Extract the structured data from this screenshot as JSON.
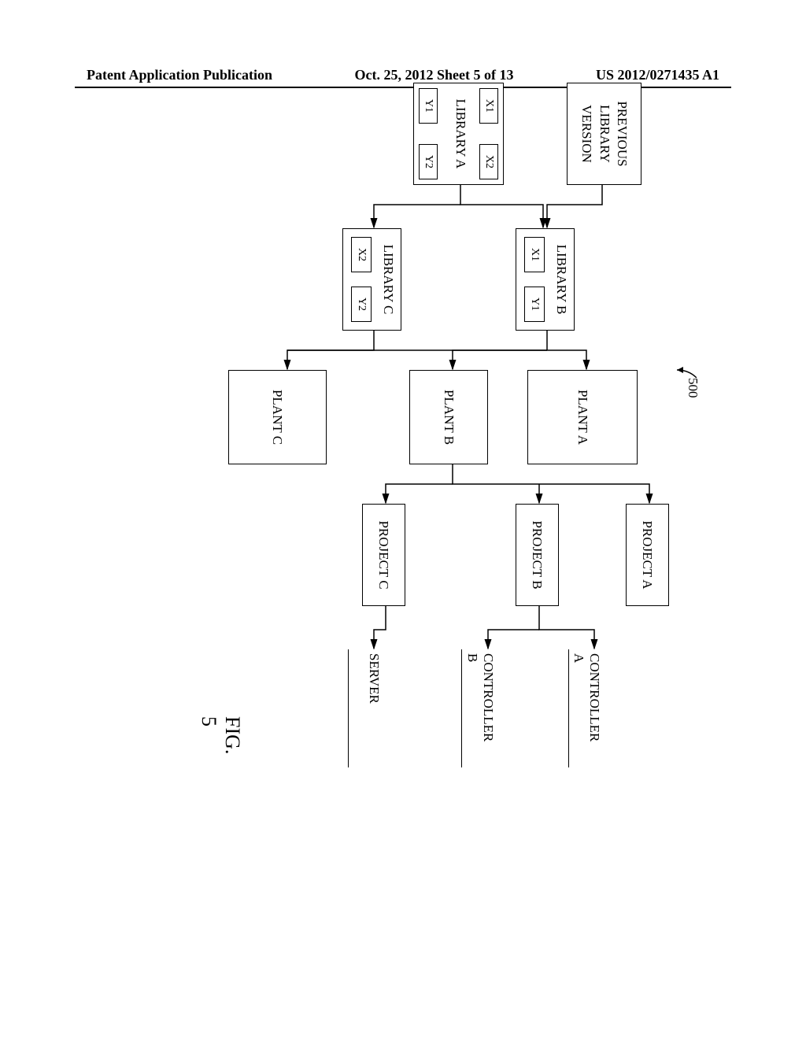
{
  "header": {
    "left": "Patent Application Publication",
    "center": "Oct. 25, 2012  Sheet 5 of 13",
    "right": "US 2012/0271435 A1"
  },
  "reference_number": "500",
  "figure_label": "FIG. 5",
  "boxes": {
    "prev_lib": "PREVIOUS\nLIBRARY\nVERSION",
    "lib_a": "LIBRARY A",
    "lib_b": "LIBRARY B",
    "lib_c": "LIBRARY C",
    "plant_a": "PLANT A",
    "plant_b": "PLANT B",
    "plant_c": "PLANT C",
    "project_a": "PROJECT A",
    "project_b": "PROJECT B",
    "project_c": "PROJECT C",
    "controller_a": "CONTROLLER A",
    "controller_b": "CONTROLLER B",
    "server": "SERVER"
  },
  "sub": {
    "x1": "X1",
    "x2": "X2",
    "y1": "Y1",
    "y2": "Y2"
  },
  "chart_data": {
    "type": "diagram",
    "title": "FIG. 5",
    "reference": "500",
    "nodes": [
      {
        "id": "prev_lib",
        "label": "PREVIOUS LIBRARY VERSION"
      },
      {
        "id": "lib_a",
        "label": "LIBRARY A",
        "sub": [
          "X1",
          "X2",
          "Y1",
          "Y2"
        ]
      },
      {
        "id": "lib_b",
        "label": "LIBRARY B",
        "sub": [
          "X1",
          "Y1"
        ]
      },
      {
        "id": "lib_c",
        "label": "LIBRARY C",
        "sub": [
          "X2",
          "Y2"
        ]
      },
      {
        "id": "plant_a",
        "label": "PLANT A"
      },
      {
        "id": "plant_b",
        "label": "PLANT B"
      },
      {
        "id": "plant_c",
        "label": "PLANT C"
      },
      {
        "id": "project_a",
        "label": "PROJECT A"
      },
      {
        "id": "project_b",
        "label": "PROJECT B"
      },
      {
        "id": "project_c",
        "label": "PROJECT C"
      },
      {
        "id": "controller_a",
        "label": "CONTROLLER A"
      },
      {
        "id": "controller_b",
        "label": "CONTROLLER B"
      },
      {
        "id": "server",
        "label": "SERVER"
      }
    ],
    "edges": [
      {
        "from": "prev_lib",
        "to": "lib_b"
      },
      {
        "from": "lib_a",
        "to": "lib_b"
      },
      {
        "from": "lib_a",
        "to": "lib_c"
      },
      {
        "from": "lib_b",
        "to": "plant_a"
      },
      {
        "from": "lib_b",
        "to": "plant_b"
      },
      {
        "from": "lib_b",
        "to": "plant_c"
      },
      {
        "from": "lib_c",
        "to": "plant_a"
      },
      {
        "from": "lib_c",
        "to": "plant_b"
      },
      {
        "from": "lib_c",
        "to": "plant_c"
      },
      {
        "from": "plant_b",
        "to": "project_a"
      },
      {
        "from": "plant_b",
        "to": "project_b"
      },
      {
        "from": "plant_b",
        "to": "project_c"
      },
      {
        "from": "project_b",
        "to": "controller_a"
      },
      {
        "from": "project_b",
        "to": "controller_b"
      },
      {
        "from": "project_c",
        "to": "server"
      }
    ]
  }
}
